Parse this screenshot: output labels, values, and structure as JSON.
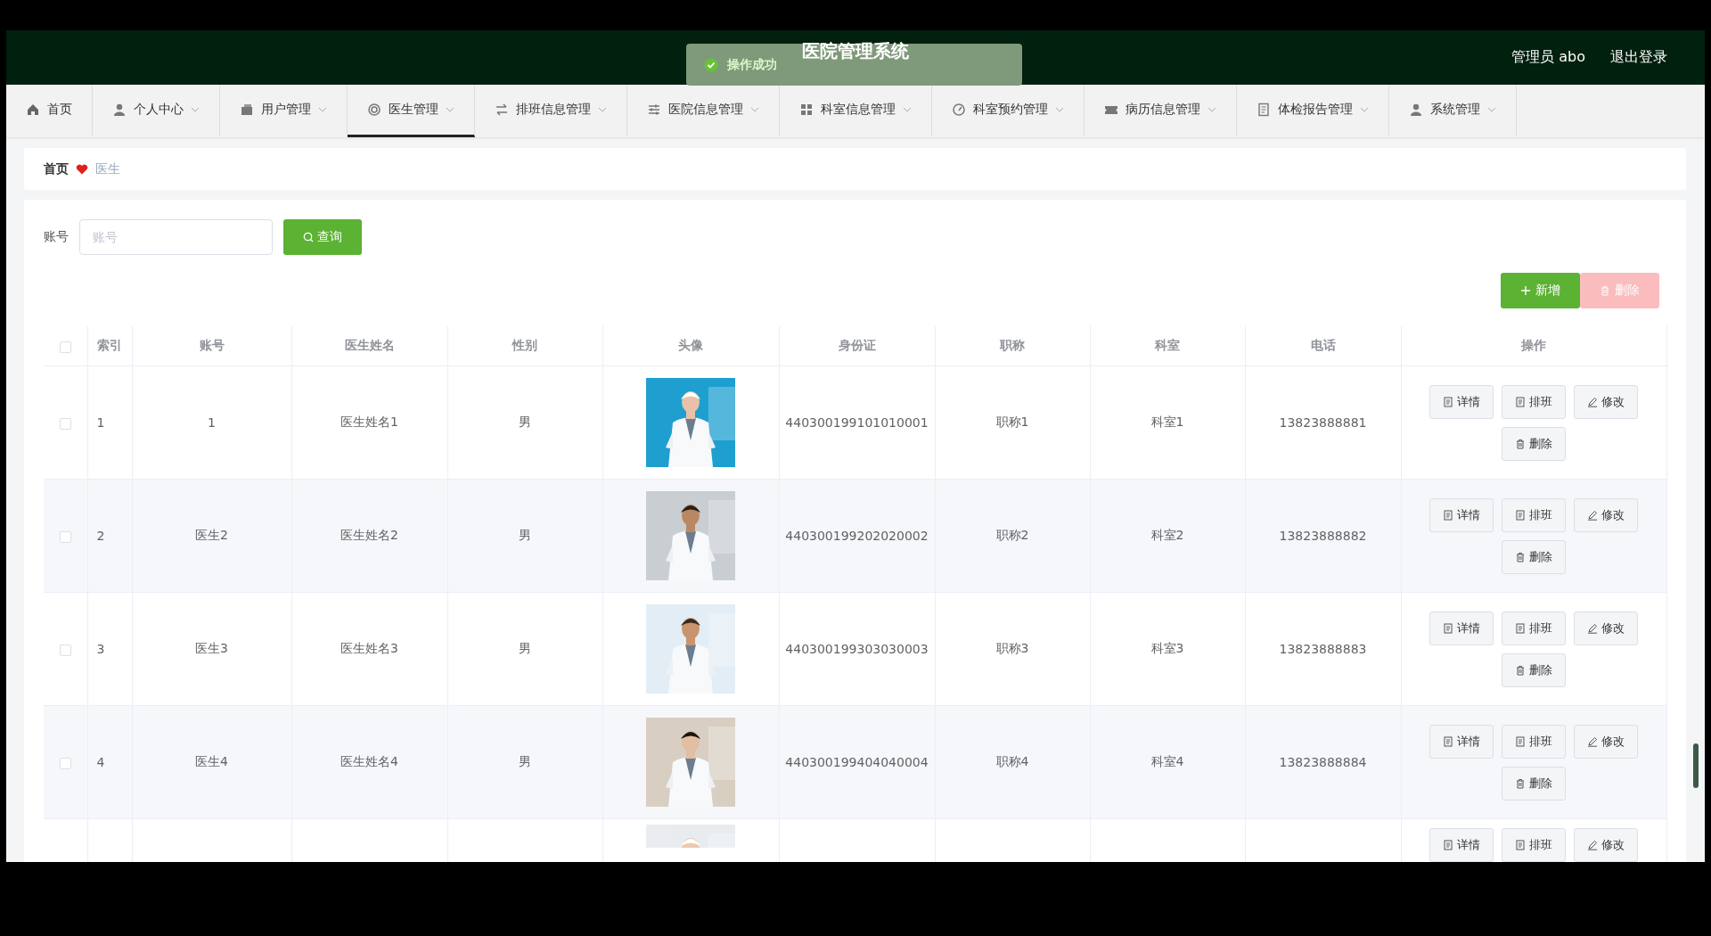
{
  "header": {
    "title": "医院管理系统",
    "user": "管理员 abo",
    "logout": "退出登录"
  },
  "toast": {
    "message": "操作成功"
  },
  "nav": [
    {
      "label": "首页",
      "dropdown": false,
      "selected": false
    },
    {
      "label": "个人中心",
      "dropdown": true,
      "selected": false
    },
    {
      "label": "用户管理",
      "dropdown": true,
      "selected": false
    },
    {
      "label": "医生管理",
      "dropdown": true,
      "selected": true
    },
    {
      "label": "排班信息管理",
      "dropdown": true,
      "selected": false
    },
    {
      "label": "医院信息管理",
      "dropdown": true,
      "selected": false
    },
    {
      "label": "科室信息管理",
      "dropdown": true,
      "selected": false
    },
    {
      "label": "科室预约管理",
      "dropdown": true,
      "selected": false
    },
    {
      "label": "病历信息管理",
      "dropdown": true,
      "selected": false
    },
    {
      "label": "体检报告管理",
      "dropdown": true,
      "selected": false
    },
    {
      "label": "系统管理",
      "dropdown": true,
      "selected": false
    }
  ],
  "breadcrumb": [
    "首页",
    "医生"
  ],
  "search": {
    "label": "账号",
    "placeholder": "账号",
    "button": "查询"
  },
  "toolbar": [
    {
      "label": "新增",
      "kind": "add",
      "disabled": false
    },
    {
      "label": "删除",
      "kind": "delete",
      "disabled": true
    }
  ],
  "table": {
    "select_all_checked": false,
    "columns": [
      "索引",
      "账号",
      "医生姓名",
      "性别",
      "头像",
      "身份证",
      "职称",
      "科室",
      "电话",
      "操作"
    ],
    "rows": [
      {
        "checked": false,
        "cells": [
          "1",
          "1",
          "医生姓名1",
          "男",
          "440300199101010001",
          "职称1",
          "科室1",
          "13823888881"
        ],
        "photo": {
          "kind": "picture"
        },
        "actions": [
          {
            "label": "详情",
            "kind": "detail"
          },
          {
            "label": "排班",
            "kind": "schedule"
          },
          {
            "label": "修改",
            "kind": "edit"
          },
          {
            "label": "删除",
            "kind": "delete"
          }
        ]
      },
      {
        "checked": false,
        "cells": [
          "2",
          "医生2",
          "医生姓名2",
          "男",
          "440300199202020002",
          "职称2",
          "科室2",
          "13823888882"
        ],
        "photo": {
          "kind": "picture"
        },
        "actions": [
          {
            "label": "详情",
            "kind": "detail"
          },
          {
            "label": "排班",
            "kind": "schedule"
          },
          {
            "label": "修改",
            "kind": "edit"
          },
          {
            "label": "删除",
            "kind": "delete"
          }
        ]
      },
      {
        "checked": false,
        "cells": [
          "3",
          "医生3",
          "医生姓名3",
          "男",
          "440300199303030003",
          "职称3",
          "科室3",
          "13823888883"
        ],
        "photo": {
          "kind": "picture"
        },
        "actions": [
          {
            "label": "详情",
            "kind": "detail"
          },
          {
            "label": "排班",
            "kind": "schedule"
          },
          {
            "label": "修改",
            "kind": "edit"
          },
          {
            "label": "删除",
            "kind": "delete"
          }
        ]
      },
      {
        "checked": false,
        "cells": [
          "4",
          "医生4",
          "医生姓名4",
          "男",
          "440300199404040004",
          "职称4",
          "科室4",
          "13823888884"
        ],
        "photo": {
          "kind": "picture"
        },
        "actions": [
          {
            "label": "详情",
            "kind": "detail"
          },
          {
            "label": "排班",
            "kind": "schedule"
          },
          {
            "label": "修改",
            "kind": "edit"
          },
          {
            "label": "删除",
            "kind": "delete"
          }
        ]
      },
      {
        "photo": {
          "kind": "picture"
        },
        "actions": [
          {
            "label": "详情",
            "kind": "detail"
          },
          {
            "label": "排班",
            "kind": "schedule"
          },
          {
            "label": "修改",
            "kind": "edit"
          }
        ]
      }
    ]
  }
}
